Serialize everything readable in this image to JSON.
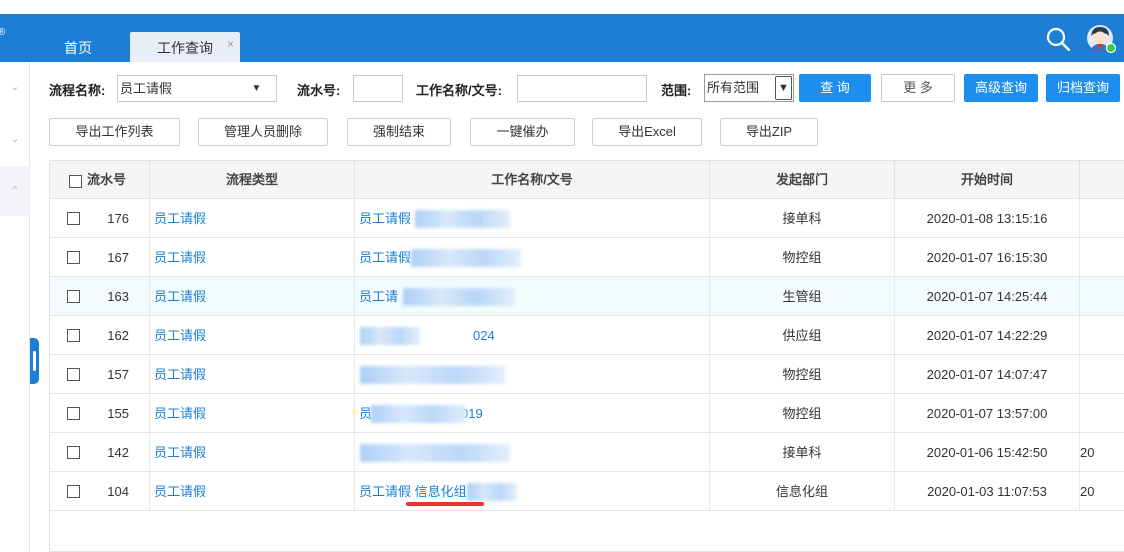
{
  "header": {
    "reg_mark": "®",
    "tabs": [
      {
        "label": "首页"
      },
      {
        "label": "工作查询",
        "close": "×"
      }
    ]
  },
  "search": {
    "flow_name_label": "流程名称:",
    "flow_name_value": "员工请假",
    "flow_name_arrow": "▼",
    "serial_label": "流水号:",
    "serial_value": "",
    "work_name_label": "工作名称/文号:",
    "work_name_value": "",
    "range_label": "范围:",
    "range_value": "所有范围",
    "query_button": "查 询",
    "more_button": "更 多",
    "advanced_button": "高级查询",
    "archive_button": "归档查询"
  },
  "actions": {
    "export_list": "导出工作列表",
    "admin_delete": "管理人员删除",
    "force_end": "强制结束",
    "one_click_urge": "一键催办",
    "export_excel": "导出Excel",
    "export_zip": "导出ZIP"
  },
  "table": {
    "columns": [
      "流水号",
      "流程类型",
      "工作名称/文号",
      "发起部门",
      "开始时间"
    ],
    "rows": [
      {
        "sn": "176",
        "type": "员工请假",
        "name_prefix": "员工请假",
        "name_suffix": "029",
        "dept": "接单科",
        "start": "2020-01-08 13:15:16",
        "extra": ""
      },
      {
        "sn": "167",
        "type": "员工请假",
        "name_prefix": "员工请假",
        "name_suffix": "",
        "dept": "物控组",
        "start": "2020-01-07 16:15:30",
        "extra": ""
      },
      {
        "sn": "163",
        "type": "员工请假",
        "name_prefix": "员工请",
        "name_suffix": "025",
        "dept": "生管组",
        "start": "2020-01-07 14:25:44",
        "extra": ""
      },
      {
        "sn": "162",
        "type": "员工请假",
        "name_prefix": "",
        "name_suffix": "024",
        "dept": "供应组",
        "start": "2020-01-07 14:22:29",
        "extra": ""
      },
      {
        "sn": "157",
        "type": "员工请假",
        "name_prefix": "",
        "name_suffix": "",
        "dept": "物控组",
        "start": "2020-01-07 14:07:47",
        "extra": ""
      },
      {
        "sn": "155",
        "type": "员工请假",
        "name_prefix": "员",
        "name_suffix": "019",
        "dept": "物控组",
        "start": "2020-01-07 13:57:00",
        "extra": ""
      },
      {
        "sn": "142",
        "type": "员工请假",
        "name_prefix": "",
        "name_suffix": "",
        "dept": "接单科",
        "start": "2020-01-06 15:42:50",
        "extra": "20"
      },
      {
        "sn": "104",
        "type": "员工请假",
        "name_prefix": "员工请假 信息化组",
        "name_suffix": "",
        "dept": "信息化组",
        "start": "2020-01-03 11:07:53",
        "extra": "20"
      }
    ]
  },
  "colors": {
    "primary": "#1d7fd4",
    "button_blue": "#1d8ef0",
    "link": "#1a7fd6",
    "annotation_red": "#e8332f"
  }
}
